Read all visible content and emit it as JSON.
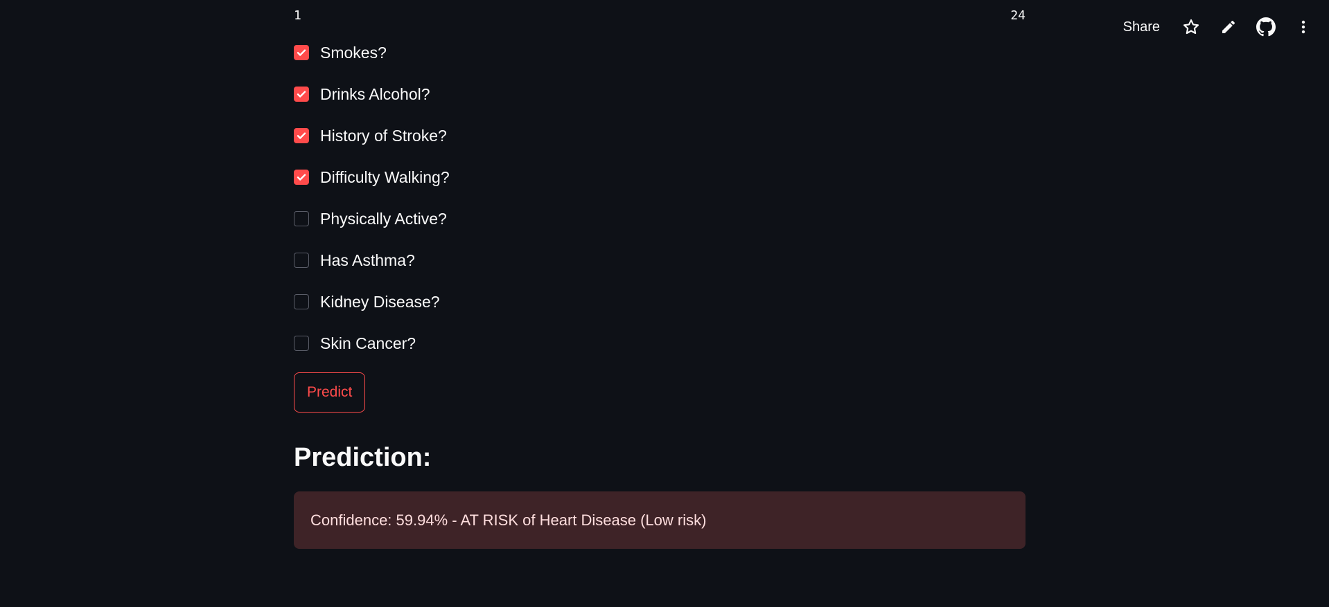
{
  "toolbar": {
    "share_label": "Share",
    "icons": [
      "star-icon",
      "pencil-icon",
      "github-icon",
      "more-vertical-icon"
    ]
  },
  "slider": {
    "min_label": "1",
    "max_label": "24"
  },
  "checkboxes": [
    {
      "label": "Smokes?",
      "checked": true
    },
    {
      "label": "Drinks Alcohol?",
      "checked": true
    },
    {
      "label": "History of Stroke?",
      "checked": true
    },
    {
      "label": "Difficulty Walking?",
      "checked": true
    },
    {
      "label": "Physically Active?",
      "checked": false
    },
    {
      "label": "Has Asthma?",
      "checked": false
    },
    {
      "label": "Kidney Disease?",
      "checked": false
    },
    {
      "label": "Skin Cancer?",
      "checked": false
    }
  ],
  "predict_button": {
    "label": "Predict"
  },
  "prediction": {
    "heading": "Prediction:",
    "result_text": "Confidence: 59.94% - AT RISK of Heart Disease (Low risk)"
  },
  "colors": {
    "background": "#0e1117",
    "accent": "#ff4b4b",
    "error_bg": "#3e2327",
    "error_text": "#ffdede",
    "text": "#fafafa"
  }
}
